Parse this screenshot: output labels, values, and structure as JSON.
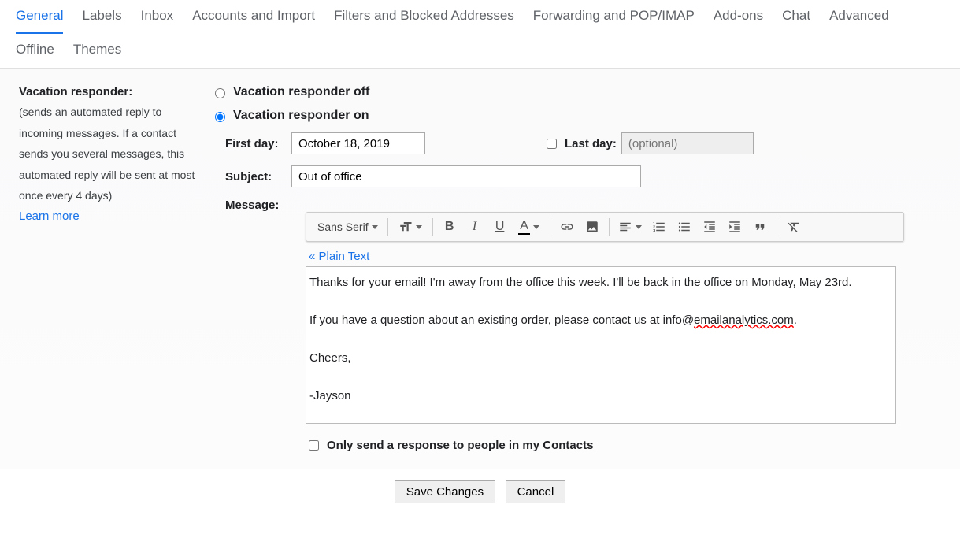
{
  "tabs": {
    "general": "General",
    "labels": "Labels",
    "inbox": "Inbox",
    "accounts": "Accounts and Import",
    "filters": "Filters and Blocked Addresses",
    "forwarding": "Forwarding and POP/IMAP",
    "addons": "Add-ons",
    "chat": "Chat",
    "advanced": "Advanced",
    "offline": "Offline",
    "themes": "Themes"
  },
  "left": {
    "title": "Vacation responder:",
    "desc": "(sends an automated reply to incoming messages. If a contact sends you several messages, this automated reply will be sent at most once every 4 days)",
    "learn": "Learn more"
  },
  "radios": {
    "off": "Vacation responder off",
    "on": "Vacation responder on"
  },
  "fields": {
    "firstday_label": "First day:",
    "firstday_value": "October 18, 2019",
    "lastday_label": "Last day:",
    "lastday_placeholder": "(optional)",
    "subject_label": "Subject:",
    "subject_value": "Out of office",
    "message_label": "Message:"
  },
  "toolbar": {
    "font": "Sans Serif"
  },
  "plaintext_link": "« Plain Text",
  "message": {
    "line1": "Thanks for your email! I'm away from the office this week. I'll be back in the office on Monday, May 23rd.",
    "line2a": "If you have a question about an existing order, please contact us at info@",
    "line2b_misspelled": "emailanalytics.com",
    "line2c": ".",
    "line3": "Cheers,",
    "line4": "-Jayson"
  },
  "contacts_only": "Only send a response to people in my Contacts",
  "footer": {
    "save": "Save Changes",
    "cancel": "Cancel"
  }
}
